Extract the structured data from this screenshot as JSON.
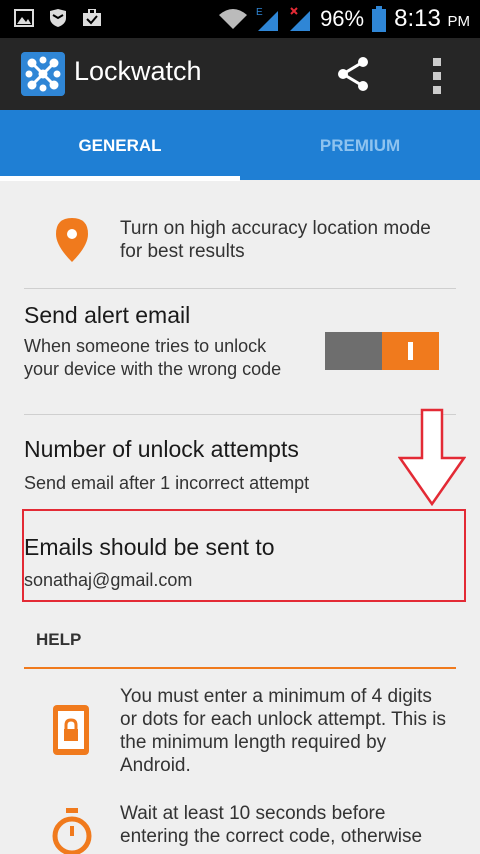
{
  "status_bar": {
    "battery_percent": "96%",
    "time": "8:13",
    "ampm": "PM",
    "network_label": "E"
  },
  "app_bar": {
    "title": "Lockwatch"
  },
  "tabs": [
    {
      "label": "GENERAL",
      "selected": true
    },
    {
      "label": "PREMIUM",
      "selected": false
    }
  ],
  "location_tip": "Turn on high accuracy location mode for best results",
  "settings": {
    "alert_email": {
      "title": "Send alert email",
      "subtitle": "When someone tries to unlock your device with the wrong code",
      "toggle_on": true
    },
    "unlock_attempts": {
      "title": "Number of unlock attempts",
      "subtitle": "Send email after 1 incorrect attempt"
    },
    "email_recipient": {
      "title": "Emails should be sent to",
      "value": "sonathaj@gmail.com"
    }
  },
  "help": {
    "title": "HELP",
    "items": [
      {
        "icon": "phone-lock-icon",
        "text": "You must enter a minimum of 4 digits or dots for each unlock attempt. This is the minimum length required by Android."
      },
      {
        "icon": "stopwatch-icon",
        "text": "Wait at least 10 seconds before entering the correct code, otherwise"
      }
    ]
  },
  "colors": {
    "accent_blue": "#1f7fd4",
    "accent_orange": "#f07a1d",
    "highlight_red": "#e32a35"
  }
}
